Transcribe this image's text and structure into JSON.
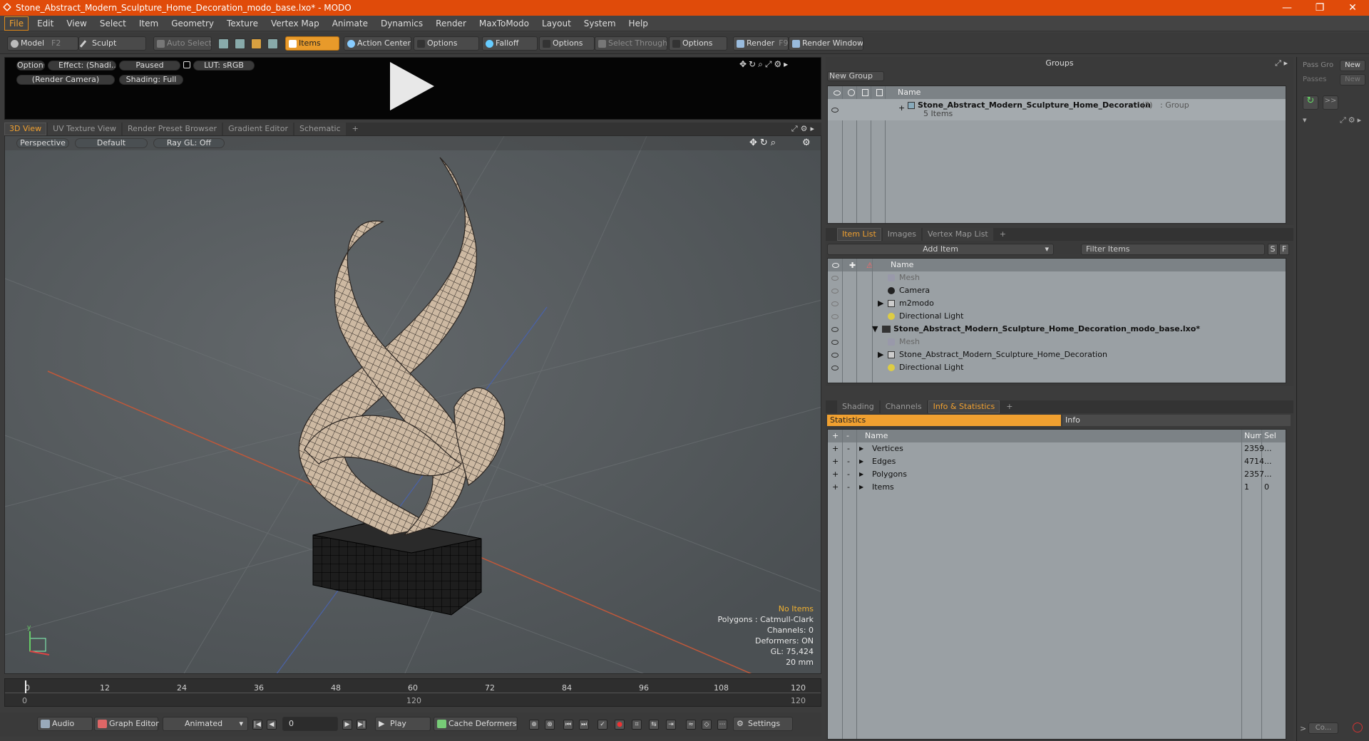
{
  "window": {
    "title": "Stone_Abstract_Modern_Sculpture_Home_Decoration_modo_base.lxo* - MODO",
    "minimize": "—",
    "maximize": "❐",
    "close": "✕"
  },
  "menu": [
    "File",
    "Edit",
    "View",
    "Select",
    "Item",
    "Geometry",
    "Texture",
    "Vertex Map",
    "Animate",
    "Dynamics",
    "Render",
    "MaxToModo",
    "Layout",
    "System",
    "Help"
  ],
  "toolbar": {
    "model": "Model",
    "model_key": "F2",
    "sculpt": "Sculpt",
    "auto_select": "Auto Select",
    "items": "Items",
    "action_center": "Action Center",
    "options1": "Options",
    "falloff": "Falloff",
    "options2": "Options",
    "select_through": "Select Through",
    "options3": "Options",
    "render": "Render",
    "render_key": "F9",
    "render_window": "Render Window"
  },
  "preview": {
    "options": "Options",
    "effect": "Effect: (Shadi...",
    "paused": "Paused",
    "lut": "LUT: sRGB",
    "camera": "(Render Camera)",
    "shading": "Shading: Full"
  },
  "viewport_tabs": [
    "3D View",
    "UV Texture View",
    "Render Preset Browser",
    "Gradient Editor",
    "Schematic",
    "+"
  ],
  "viewport": {
    "perspective": "Perspective",
    "default": "Default",
    "raygl": "Ray GL: Off",
    "info": {
      "no_items": "No Items",
      "polygons": "Polygons : Catmull-Clark",
      "channels": "Channels: 0",
      "deformers": "Deformers: ON",
      "gl": "GL: 75,424",
      "mm": "20 mm"
    }
  },
  "timeline": {
    "ticks": [
      "0",
      "12",
      "24",
      "36",
      "48",
      "60",
      "72",
      "84",
      "96",
      "108",
      "120"
    ],
    "start": "0",
    "mid": "120",
    "end": "120"
  },
  "bottom": {
    "audio": "Audio",
    "graph_editor": "Graph Editor",
    "animated": "Animated",
    "frame": "0",
    "play": "Play",
    "cache": "Cache Deformers",
    "settings": "Settings"
  },
  "groups": {
    "title": "Groups",
    "new_group": "New Group",
    "col_name": "Name",
    "row_name": "Stone_Abstract_Modern_Sculpture_Home_Decoration",
    "row_count": "(3)",
    "row_type": ": Group",
    "row_sub": "5 Items"
  },
  "itemlist": {
    "tabs": [
      "Item List",
      "Images",
      "Vertex Map List",
      "+"
    ],
    "add_item": "Add Item",
    "filter": "Filter Items",
    "s": "S",
    "f": "F",
    "col_name": "Name",
    "rows": [
      "Mesh",
      "Camera",
      "m2modo",
      "Directional Light",
      "Stone_Abstract_Modern_Sculpture_Home_Decoration_modo_base.lxo*",
      "Mesh",
      "Stone_Abstract_Modern_Sculpture_Home_Decoration",
      "Directional Light"
    ]
  },
  "stats": {
    "tabs": [
      "Shading",
      "Channels",
      "Info & Statistics",
      "+"
    ],
    "statistics": "Statistics",
    "info": "Info",
    "col_name": "Name",
    "col_num": "Num",
    "col_sel": "Sel",
    "rows": [
      {
        "name": "Vertices",
        "num": "2359",
        "sel": "..."
      },
      {
        "name": "Edges",
        "num": "4714",
        "sel": "..."
      },
      {
        "name": "Polygons",
        "num": "2357",
        "sel": "..."
      },
      {
        "name": "Items",
        "num": "1",
        "sel": "0"
      }
    ]
  },
  "rightstrip": {
    "pass_group": "Pass Gro",
    "new1": "New",
    "passes": "Passes",
    "new2": "New",
    "co": "Co..."
  }
}
